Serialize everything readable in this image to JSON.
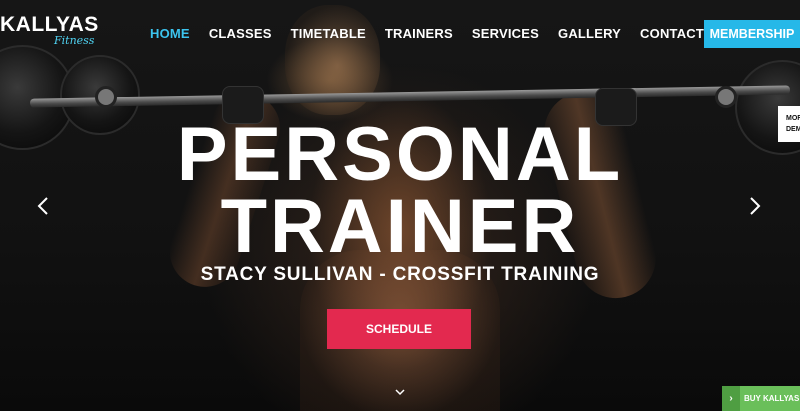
{
  "brand": {
    "name": "KALLYAS",
    "tagline": "Fitness"
  },
  "nav": {
    "items": [
      {
        "label": "HOME",
        "active": true
      },
      {
        "label": "CLASSES"
      },
      {
        "label": "TIMETABLE"
      },
      {
        "label": "TRAINERS"
      },
      {
        "label": "SERVICES"
      },
      {
        "label": "GALLERY"
      },
      {
        "label": "CONTACT US"
      }
    ],
    "cta_label": "MEMBERSHIP"
  },
  "side_tab": {
    "line1": "MOR",
    "line2": "DEM"
  },
  "hero": {
    "title_line1": "PERSONAL",
    "title_line2": "TRAINER",
    "subtitle": "STACY SULLIVAN - CROSSFIT TRAINING",
    "button_label": "SCHEDULE"
  },
  "buy_bar": {
    "label": "BUY KALLYAS THE"
  },
  "colors": {
    "accent": "#3cc4ee",
    "membership": "#26b8e8",
    "schedule": "#e3294f",
    "buy": "#6abf5a"
  },
  "icons": {
    "prev": "chevron-left-icon",
    "next": "chevron-right-icon",
    "scroll": "chevron-down-icon"
  }
}
